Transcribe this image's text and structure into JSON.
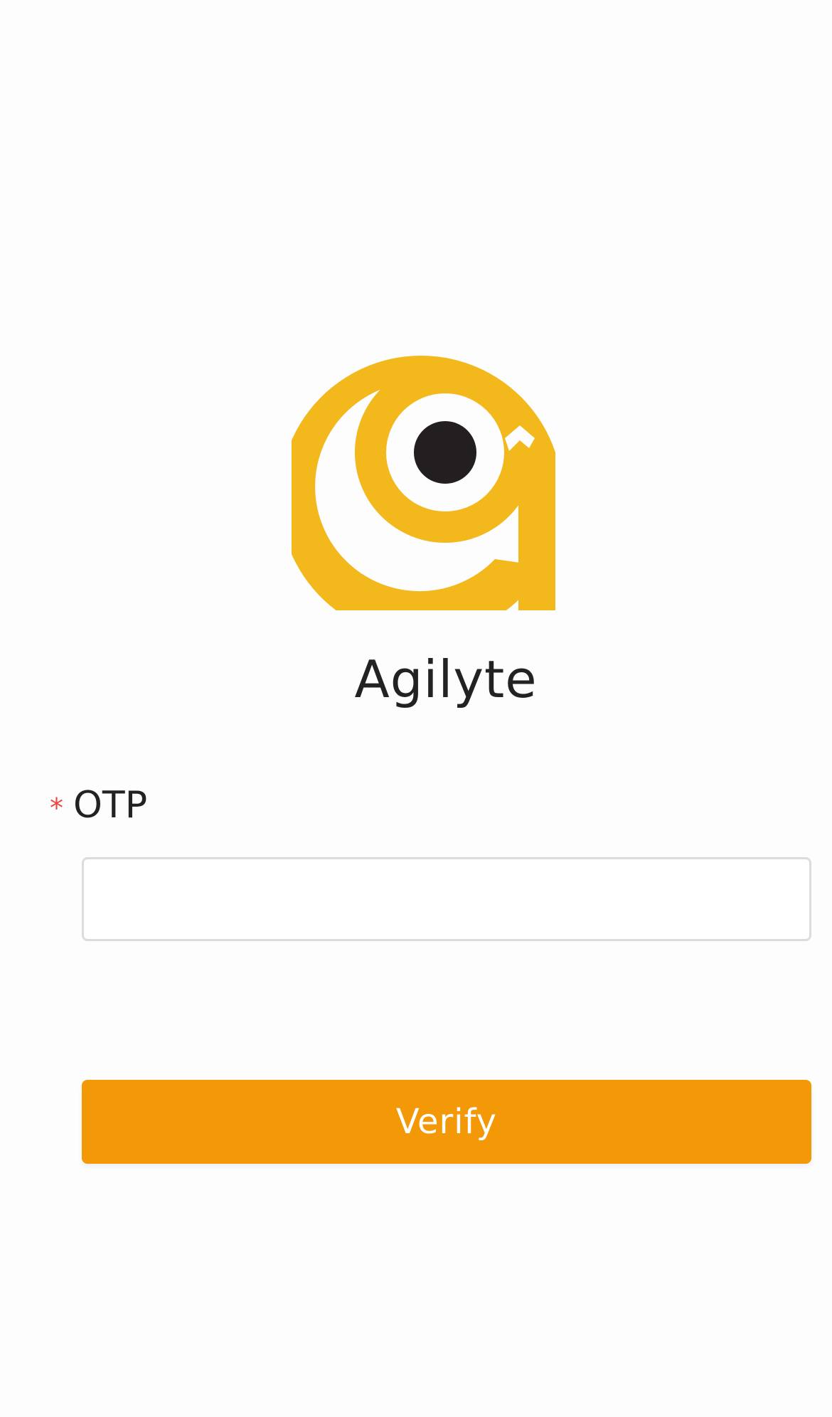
{
  "app": {
    "name": "Agilyte"
  },
  "form": {
    "required_marker": "*",
    "otp_label": "OTP",
    "otp_value": "",
    "otp_placeholder": ""
  },
  "actions": {
    "verify_label": "Verify"
  },
  "icons": {
    "logo": "agilyte-logo-icon"
  },
  "colors": {
    "logo_yellow": "#f2b81c",
    "logo_dark": "#231f20",
    "button_orange": "#f39806",
    "required_red": "#ee4444",
    "text_dark": "#222222"
  }
}
